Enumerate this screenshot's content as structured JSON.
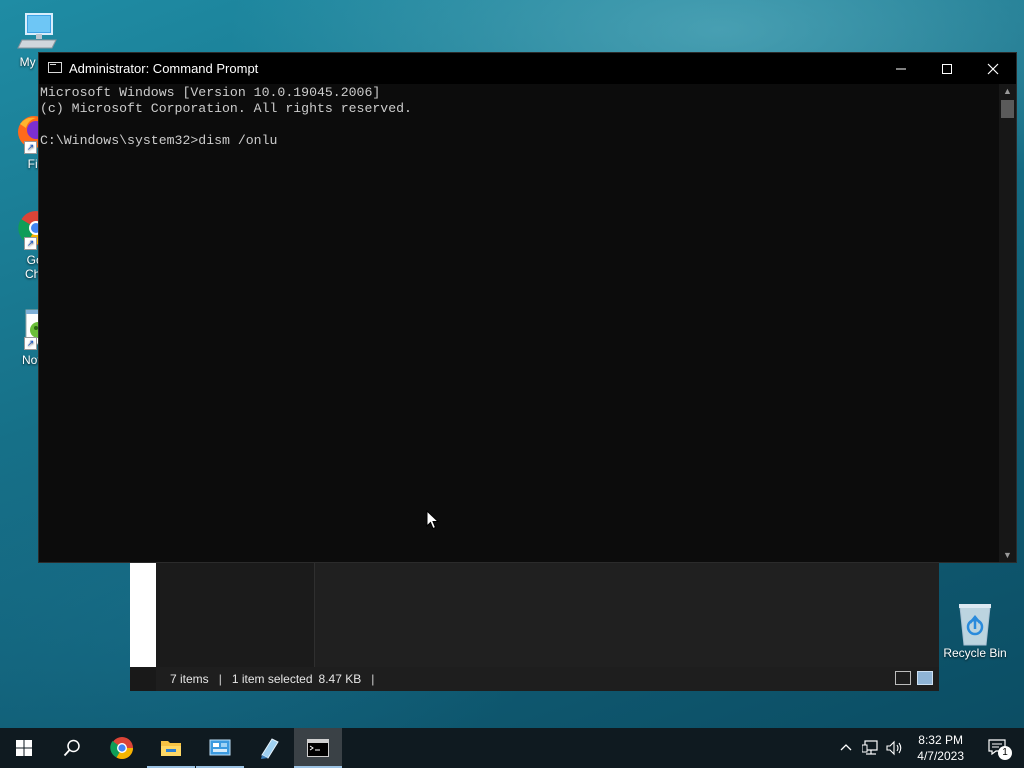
{
  "desktop": {
    "icons": [
      {
        "label": "My Co",
        "icon": "computer-icon"
      },
      {
        "label": "Fire",
        "icon": "firefox-icon"
      },
      {
        "label": "Goo",
        "label2": "Chro",
        "icon": "chrome-icon"
      },
      {
        "label": "Notep",
        "icon": "notepad-icon"
      }
    ],
    "recycle_bin": {
      "label": "Recycle Bin",
      "icon": "recycle-bin-icon"
    }
  },
  "cmd_window": {
    "title": "Administrator: Command Prompt",
    "lines": [
      "Microsoft Windows [Version 10.0.19045.2006]",
      "(c) Microsoft Corporation. All rights reserved.",
      "",
      "C:\\Windows\\system32>dism /onlu"
    ],
    "background": "#0c0c0c",
    "text_color": "#cccccc"
  },
  "explorer_window": {
    "status": {
      "items": "7 items",
      "selected": "1 item selected",
      "size": "8.47 KB"
    }
  },
  "taskbar": {
    "apps": [
      {
        "name": "start-icon"
      },
      {
        "name": "search-icon"
      },
      {
        "name": "chrome-icon"
      },
      {
        "name": "file-explorer-icon"
      },
      {
        "name": "control-panel-icon"
      },
      {
        "name": "notepad-pen-icon"
      },
      {
        "name": "command-prompt-icon",
        "active": true
      }
    ],
    "clock": {
      "time": "8:32 PM",
      "date": "4/7/2023"
    },
    "notifications_count": "1"
  }
}
